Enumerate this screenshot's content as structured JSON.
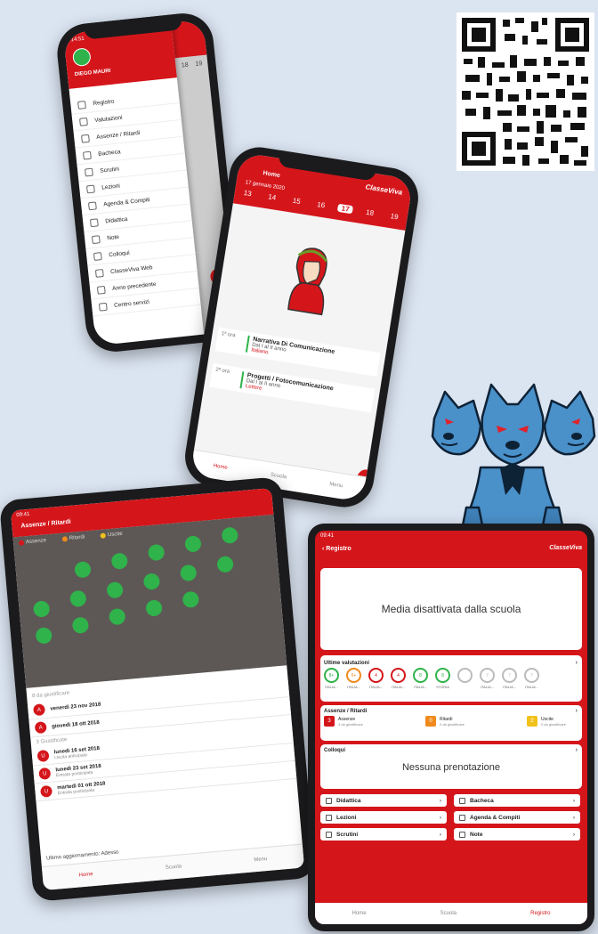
{
  "colors": {
    "background": "#dbe5f2",
    "brand_red": "#d4161b",
    "green": "#2fb34a",
    "orange": "#f08a1c",
    "yellow": "#f2c21b"
  },
  "brand": {
    "logo_text": "ClasseViva"
  },
  "drawer_phone": {
    "time": "14:51",
    "user_name": "DIEGO MAURI",
    "days": [
      "18",
      "19"
    ],
    "menu": [
      {
        "icon": "register-icon",
        "label": "Registro"
      },
      {
        "icon": "grades-icon",
        "label": "Valutazioni"
      },
      {
        "icon": "absence-icon",
        "label": "Assenze / Ritardi"
      },
      {
        "icon": "noticeboard-icon",
        "label": "Bacheca"
      },
      {
        "icon": "scrutini-icon",
        "label": "Scrutini"
      },
      {
        "icon": "lessons-icon",
        "label": "Lezioni"
      },
      {
        "icon": "agenda-icon",
        "label": "Agenda & Compiti"
      },
      {
        "icon": "didactic-icon",
        "label": "Didattica"
      },
      {
        "icon": "note-icon",
        "label": "Note"
      },
      {
        "icon": "meetings-icon",
        "label": "Colloqui"
      },
      {
        "icon": "cv-icon",
        "label": "ClasseViva Web"
      },
      {
        "icon": "previous-year-icon",
        "label": "Anno precedente"
      },
      {
        "icon": "services-icon",
        "label": "Centro servizi"
      }
    ]
  },
  "calendar_phone": {
    "title": "Home",
    "date_header": "17 gennaio 2020",
    "days": [
      "13",
      "14",
      "15",
      "16",
      "17",
      "18",
      "19"
    ],
    "selected_day": "17",
    "lessons": [
      {
        "time": "1ª ora",
        "title": "Narrativa Di Comunicazione",
        "subtitle": "Dal I al II anno",
        "meta": "Italiano"
      },
      {
        "time": "2ª ora",
        "title": "Progetti / Fotocomunicazione",
        "subtitle": "Dal I al II anno",
        "meta": "Lettere"
      }
    ],
    "tabs": [
      "Home",
      "Scuola",
      "Menu"
    ]
  },
  "absence_tablet": {
    "time": "09:41",
    "title": "Assenze / Ritardi",
    "legend": [
      "Assenze",
      "Ritardi",
      "Uscite"
    ],
    "section_one": "8 da giustificare",
    "items_one": [
      "venerdì 23 nov 2018",
      "giovedì 18 ott 2018"
    ],
    "section_two": "3 Giustificate",
    "items_two": [
      {
        "date": "lunedì 16 set 2018",
        "detail": "Uscita anticipata"
      },
      {
        "date": "lunedì 23 set 2018",
        "detail": "Entrata posticipata"
      },
      {
        "date": "martedì 01 ott 2018",
        "detail": "Entrata posticipata"
      }
    ],
    "footer_note": "Ultimo aggiornamento: Adesso",
    "tabs": [
      "Home",
      "Scuola",
      "Menu"
    ]
  },
  "register_tablet": {
    "time": "09:41",
    "back_label": "Registro",
    "average_message": "Media disattivata dalla scuola",
    "grades_title": "Ultime valutazioni",
    "grades": [
      {
        "value": "8+",
        "label": "ITALIA...",
        "color": "#2fb34a"
      },
      {
        "value": "6+",
        "label": "ITALIA...",
        "color": "#f08a1c"
      },
      {
        "value": "4",
        "label": "ITALIA...",
        "color": "#d4161b"
      },
      {
        "value": "4",
        "label": "ITALIA...",
        "color": "#d4161b"
      },
      {
        "value": "8",
        "label": "ITALIA...",
        "color": "#2fb34a"
      },
      {
        "value": "8",
        "label": "STORIA",
        "color": "#2fb34a"
      },
      {
        "value": "",
        "label": "",
        "color": "#bbbbbb"
      },
      {
        "value": "7",
        "label": "ITALIA...",
        "color": "#bbbbbb"
      },
      {
        "value": "7",
        "label": "ITALIA...",
        "color": "#bbbbbb"
      },
      {
        "value": "7",
        "label": "ITALIA...",
        "color": "#bbbbbb"
      }
    ],
    "absences_title": "Assenze / Ritardi",
    "absences": [
      {
        "count": "3",
        "label": "Assenze",
        "sub": "3 da giustificare",
        "color": "#d4161b"
      },
      {
        "count": "0",
        "label": "Ritardi",
        "sub": "0 da giustificare",
        "color": "#f08a1c"
      },
      {
        "count": "2",
        "label": "Uscite",
        "sub": "0 da giustificare",
        "color": "#f2c21b"
      }
    ],
    "meetings_title": "Colloqui",
    "meetings_message": "Nessuna prenotazione",
    "nav": [
      {
        "icon": "didactic-icon",
        "label": "Didattica"
      },
      {
        "icon": "noticeboard-icon",
        "label": "Bacheca"
      },
      {
        "icon": "lessons-icon",
        "label": "Lezioni"
      },
      {
        "icon": "agenda-icon",
        "label": "Agenda & Compiti"
      },
      {
        "icon": "scrutini-icon",
        "label": "Scrutini"
      },
      {
        "icon": "note-icon",
        "label": "Note"
      }
    ],
    "tabs": [
      "Home",
      "Scuola",
      "Registro"
    ]
  }
}
